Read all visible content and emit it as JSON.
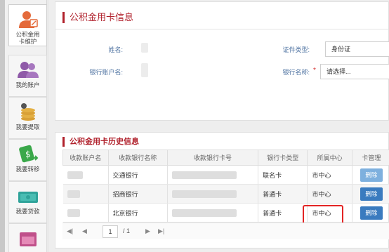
{
  "sidebar": {
    "items": [
      {
        "label": "公积金用卡维护",
        "icon": "person-edit-icon",
        "active": true
      },
      {
        "label": "我的账户",
        "icon": "users-icon"
      },
      {
        "label": "我要提取",
        "icon": "coins-icon"
      },
      {
        "label": "我要转移",
        "icon": "transfer-icon"
      },
      {
        "label": "我要贷款",
        "icon": "money-icon"
      }
    ]
  },
  "card_info": {
    "title": "公积金用卡信息",
    "name_label": "姓名:",
    "id_type_label": "证件类型:",
    "id_type_value": "身份证",
    "account_name_label": "银行账户名:",
    "bank_name_label": "银行名称:",
    "required_mark": "*",
    "bank_name_placeholder": "请选择..."
  },
  "history": {
    "title": "公积金用卡历史信息",
    "columns": [
      "收款账户名",
      "收款银行名称",
      "收款银行卡号",
      "银行卡类型",
      "所属中心",
      "卡管理"
    ],
    "rows": [
      {
        "bank": "交通银行",
        "card_type": "联名卡",
        "center": "市中心",
        "action": "删除"
      },
      {
        "bank": "招商银行",
        "card_type": "普通卡",
        "center": "市中心",
        "action": "删除"
      },
      {
        "bank": "北京银行",
        "card_type": "普通卡",
        "center": "市中心",
        "action": "删除"
      }
    ]
  },
  "pager": {
    "first": "◀|",
    "prev": "◀",
    "page": "1",
    "total": "/ 1",
    "next": "▶",
    "last": "▶|"
  },
  "colors": {
    "accent": "#b0202b",
    "button": "#3a7bbf",
    "highlight": "#e32424"
  }
}
